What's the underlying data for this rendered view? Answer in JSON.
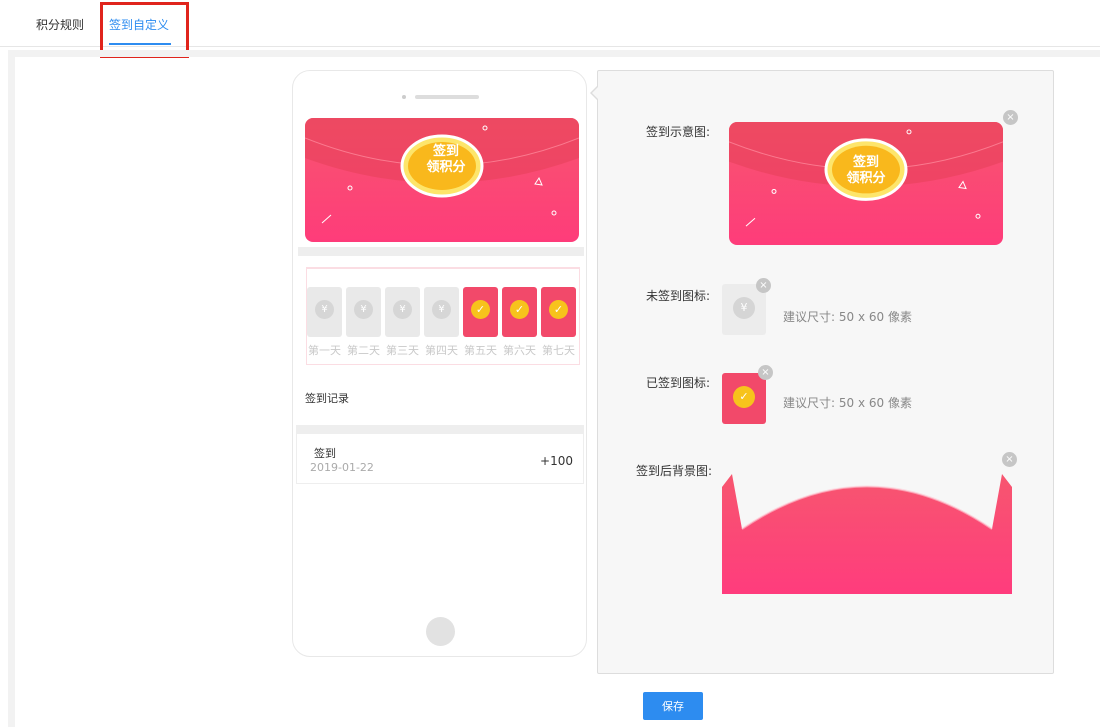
{
  "tabs": [
    {
      "label": "积分规则"
    },
    {
      "label": "签到自定义"
    }
  ],
  "banner": {
    "text_line1": "签到",
    "text_line2": "领积分"
  },
  "phone": {
    "days": [
      {
        "label": "第一天",
        "signed": false
      },
      {
        "label": "第二天",
        "signed": false
      },
      {
        "label": "第三天",
        "signed": false
      },
      {
        "label": "第四天",
        "signed": false
      },
      {
        "label": "第五天",
        "signed": true
      },
      {
        "label": "第六天",
        "signed": true
      },
      {
        "label": "第七天",
        "signed": true
      }
    ],
    "records_title": "签到记录",
    "records": [
      {
        "name": "签到",
        "date": "2019-01-22",
        "points": "+100"
      }
    ]
  },
  "icons": {
    "yen": "¥",
    "check": "✓",
    "close": "×"
  },
  "settings": {
    "sign_image_label": "签到示意图:",
    "unsigned_icon_label": "未签到图标:",
    "signed_icon_label": "已签到图标:",
    "bg_image_label": "签到后背景图:",
    "size_hint": "建议尺寸: 50 x 60 像素"
  },
  "colors": {
    "accent": "#2d8cf0",
    "red": "#f2496a",
    "gold": "#f7c31c",
    "highlight_border": "#e0241c"
  },
  "save_label": "保存"
}
